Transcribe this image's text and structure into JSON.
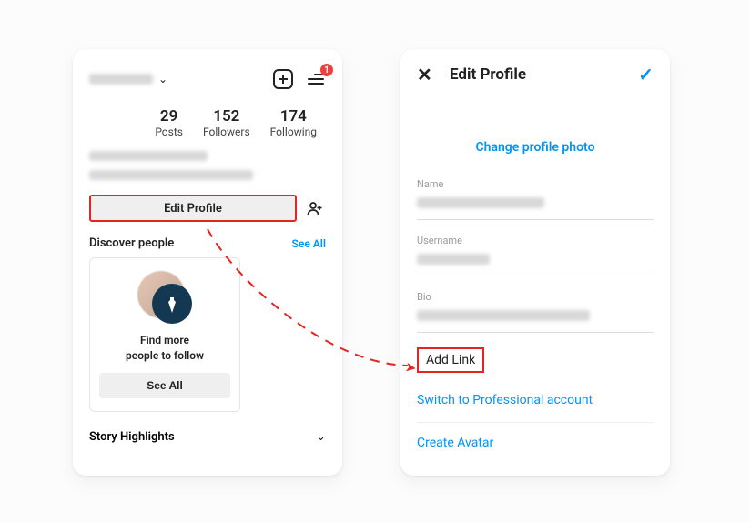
{
  "left": {
    "menu_badge": "1",
    "stats": [
      {
        "num": "29",
        "label": "Posts"
      },
      {
        "num": "152",
        "label": "Followers"
      },
      {
        "num": "174",
        "label": "Following"
      }
    ],
    "edit_profile": "Edit Profile",
    "discover_title": "Discover people",
    "see_all": "See All",
    "card_text": "Find more\npeople to follow",
    "card_button": "See All",
    "story_title": "Story Highlights"
  },
  "right": {
    "title": "Edit Profile",
    "change_photo": "Change profile photo",
    "field_name_label": "Name",
    "field_username_label": "Username",
    "field_bio_label": "Bio",
    "add_link": "Add Link",
    "switch_pro": "Switch to Professional account",
    "create_avatar": "Create Avatar"
  }
}
